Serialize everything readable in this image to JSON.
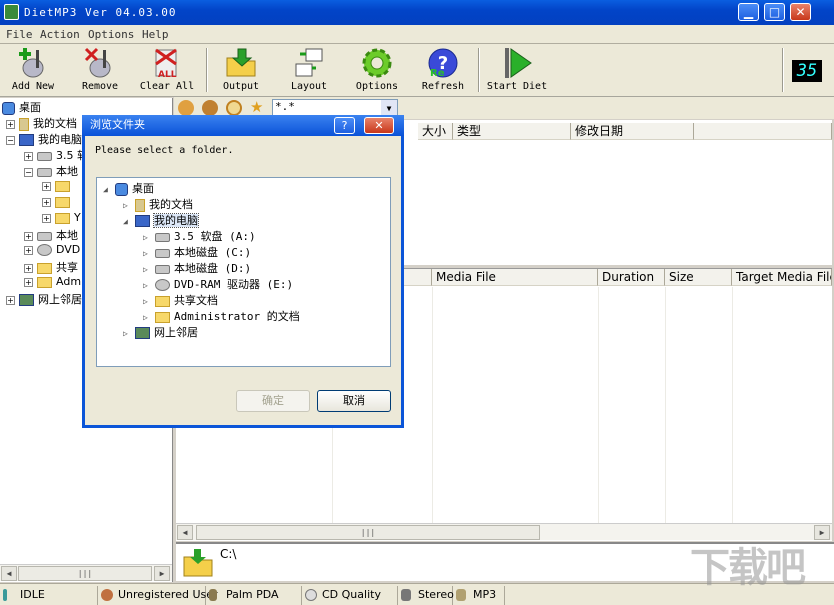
{
  "window": {
    "title": "DietMP3  Ver 04.03.00",
    "min_glyph": "▁",
    "max_glyph": "□",
    "close_glyph": "✕"
  },
  "menu": [
    "File",
    "Action",
    "Options",
    "Help"
  ],
  "toolbar": {
    "buttons": [
      {
        "label": "Add New",
        "icon": "add-file-icon"
      },
      {
        "label": "Remove",
        "icon": "remove-file-icon"
      },
      {
        "label": "Clear All",
        "icon": "clear-all-icon"
      },
      {
        "label": "Output",
        "icon": "output-folder-icon"
      },
      {
        "label": "Layout",
        "icon": "layout-icon"
      },
      {
        "label": "Options",
        "icon": "gear-icon"
      },
      {
        "label": "Refresh",
        "icon": "refresh-icon"
      },
      {
        "label": "Start Diet",
        "icon": "play-icon"
      }
    ],
    "lcd": "35"
  },
  "left_tree": [
    {
      "label": "桌面",
      "kind": "desktop",
      "expander": ""
    },
    {
      "label": "我的文档",
      "kind": "docs",
      "expander": "+"
    },
    {
      "label": "我的电脑",
      "kind": "computer",
      "expander": "−"
    },
    {
      "label": "3.5 软",
      "kind": "drive",
      "expander": "+"
    },
    {
      "label": "本地",
      "kind": "drive",
      "expander": "−"
    },
    {
      "label": "",
      "kind": "folder",
      "expander": "+"
    },
    {
      "label": "",
      "kind": "folder",
      "expander": "+"
    },
    {
      "label": "Y",
      "kind": "folder",
      "expander": "+"
    },
    {
      "label": "本地",
      "kind": "drive",
      "expander": "+"
    },
    {
      "label": "DVD",
      "kind": "drive",
      "expander": "+"
    },
    {
      "label": "共享",
      "kind": "folder",
      "expander": "+"
    },
    {
      "label": "Adm",
      "kind": "folder",
      "expander": "+"
    },
    {
      "label": "网上邻居",
      "kind": "network",
      "expander": "+"
    }
  ],
  "filter_combo": "*.*",
  "file_columns": [
    "大小",
    "类型",
    "修改日期"
  ],
  "media_columns": [
    "Media File",
    "Duration",
    "Size",
    "Target Media File"
  ],
  "output_path": "C:\\",
  "status": [
    "IDLE",
    "Unregistered User",
    "Palm PDA",
    "CD Quality",
    "Stereo",
    "MP3"
  ],
  "dialog": {
    "title": "浏览文件夹",
    "help_glyph": "?",
    "close_glyph": "✕",
    "prompt": "Please select a folder.",
    "tree": [
      {
        "label": "桌面",
        "kind": "desktop",
        "expander": "◢"
      },
      {
        "label": "我的文档",
        "kind": "docs",
        "expander": "▷"
      },
      {
        "label": "我的电脑",
        "kind": "computer",
        "expander": "◢",
        "selected": true
      },
      {
        "label": "3.5 软盘 (A:)",
        "kind": "drive",
        "expander": "▷"
      },
      {
        "label": "本地磁盘 (C:)",
        "kind": "drive",
        "expander": "▷"
      },
      {
        "label": "本地磁盘 (D:)",
        "kind": "drive",
        "expander": "▷"
      },
      {
        "label": "DVD-RAM 驱动器 (E:)",
        "kind": "drive",
        "expander": "▷"
      },
      {
        "label": "共享文档",
        "kind": "folder",
        "expander": "▷"
      },
      {
        "label": "Administrator 的文档",
        "kind": "folder",
        "expander": "▷"
      },
      {
        "label": "网上邻居",
        "kind": "network",
        "expander": "▷"
      }
    ],
    "ok_label": "确定",
    "cancel_label": "取消"
  },
  "watermark": "下载吧"
}
